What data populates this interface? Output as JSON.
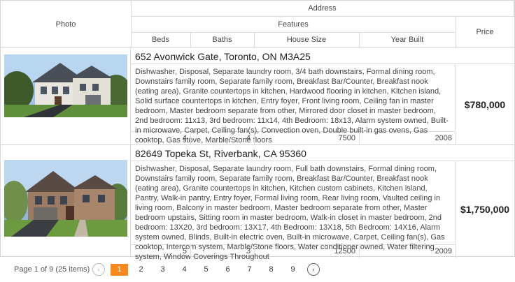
{
  "headers": {
    "photo": "Photo",
    "address": "Address",
    "features": "Features",
    "beds": "Beds",
    "baths": "Baths",
    "house_size": "House Size",
    "year_built": "Year Built",
    "price": "Price"
  },
  "rows": [
    {
      "address": "652 Avonwick Gate, Toronto, ON M3A25",
      "features": "Dishwasher, Disposal, Separate laundry room, 3/4 bath downstairs, Formal dining room, Downstairs family room, Separate family room, Breakfast Bar/Counter, Breakfast nook (eating area), Granite countertops in kitchen, Hardwood flooring in kitchen, Kitchen island, Solid surface countertops in kitchen, Entry foyer, Front living room, Ceiling fan in master bedroom, Master bedroom separate from other, Mirrored door closet in master bedroom, 2nd bedroom: 11x13, 3rd bedroom: 11x14, 4th Bedroom: 18x13, Alarm system owned, Built-in microwave, Carpet, Ceiling fan(s), Convection oven, Double built-in gas ovens, Gas cooktop, Gas stove, Marble/Stone floors",
      "beds": "4",
      "baths": "4",
      "house_size": "7500",
      "year_built": "2008",
      "price": "$780,000"
    },
    {
      "address": "82649 Topeka St, Riverbank, CA 95360",
      "features": "Dishwasher, Disposal, Separate laundry room, Full bath downstairs, Formal dining room, Downstairs family room, Separate family room, Breakfast Bar/Counter, Breakfast nook (eating area), Granite countertops in kitchen, Kitchen custom cabinets, Kitchen island, Pantry, Walk-in pantry, Entry foyer, Formal living room, Rear living room, Vaulted ceiling in living room, Balcony in master bedroom, Master bedroom separate from other, Master bedroom upstairs, Sitting room in master bedroom, Walk-in closet in master bedroom, 2nd bedroom: 13X20, 3rd bedroom: 13X17, 4th Bedroom: 13X18, 5th Bedroom: 14X16, Alarm system owned, Blinds, Built-in electric oven, Built-in microwave, Carpet, Ceiling fan(s), Gas cooktop, Intercom system, Marble/Stone floors, Water conditioner owned, Water filtering system, Window Coverings Throughout",
      "beds": "5",
      "baths": "3",
      "house_size": "12500",
      "year_built": "2009",
      "price": "$1,750,000"
    }
  ],
  "pager": {
    "info": "Page 1 of 9 (25 items)",
    "prev": "‹",
    "next": "›",
    "pages": [
      "1",
      "2",
      "3",
      "4",
      "5",
      "6",
      "7",
      "8",
      "9"
    ],
    "current": "1"
  },
  "colors": {
    "accent": "#f7891e",
    "border": "#d6d6d6"
  }
}
